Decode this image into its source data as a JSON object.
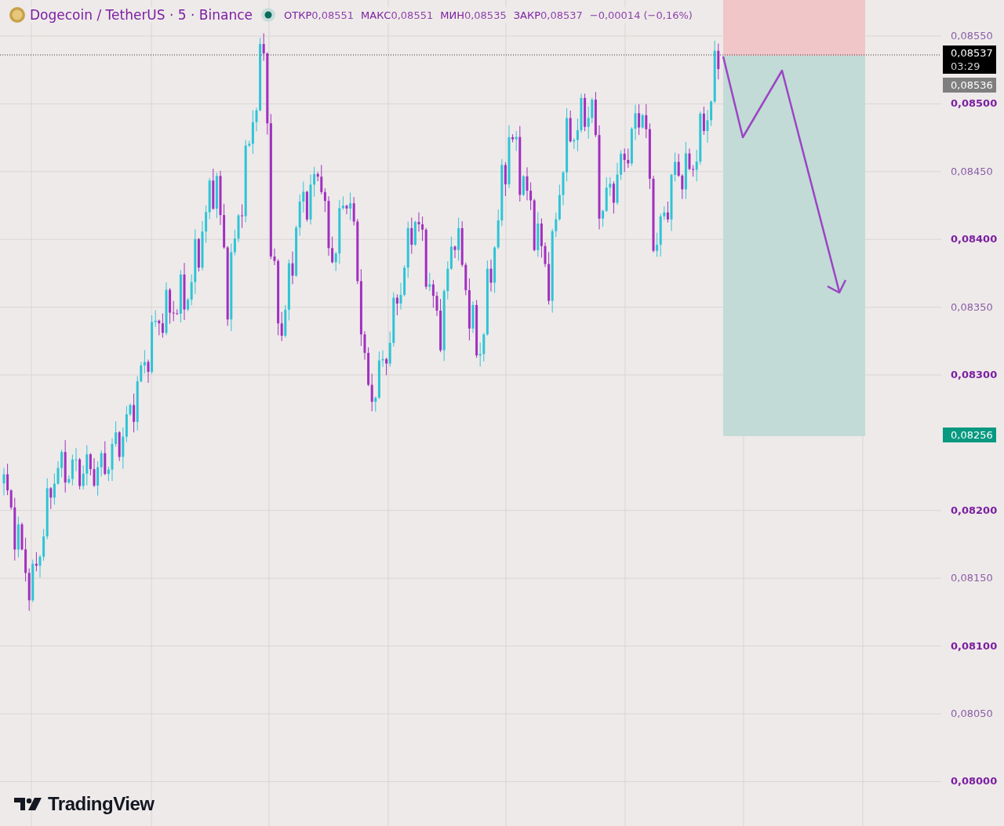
{
  "header": {
    "symbol": "Dogecoin / TetherUS · 5 · Binance",
    "ohlc": [
      {
        "label": "ОТКР",
        "value": "0,08551"
      },
      {
        "label": "МАКС",
        "value": "0,08551"
      },
      {
        "label": "МИН",
        "value": "0,08535"
      },
      {
        "label": "ЗАКР",
        "value": "0,08537"
      }
    ],
    "change": "−0,00014 (−0,16%)"
  },
  "price_axis": {
    "ticks": [
      {
        "label": "0,08550",
        "major": false
      },
      {
        "label": "0,08500",
        "major": true
      },
      {
        "label": "0,08450",
        "major": false
      },
      {
        "label": "0,08400",
        "major": true
      },
      {
        "label": "0,08350",
        "major": false
      },
      {
        "label": "0,08300",
        "major": true
      },
      {
        "label": "0,08200",
        "major": true
      },
      {
        "label": "0,08150",
        "major": false
      },
      {
        "label": "0,08100",
        "major": true
      },
      {
        "label": "0,08050",
        "major": false
      },
      {
        "label": "0,08000",
        "major": true
      }
    ],
    "price_labels": [
      {
        "kind": "last",
        "value": "0,08537",
        "timer": "03:29"
      },
      {
        "kind": "prev",
        "value": "0,08536"
      },
      {
        "kind": "target",
        "value": "0,08256"
      }
    ]
  },
  "logo": "TradingView"
}
